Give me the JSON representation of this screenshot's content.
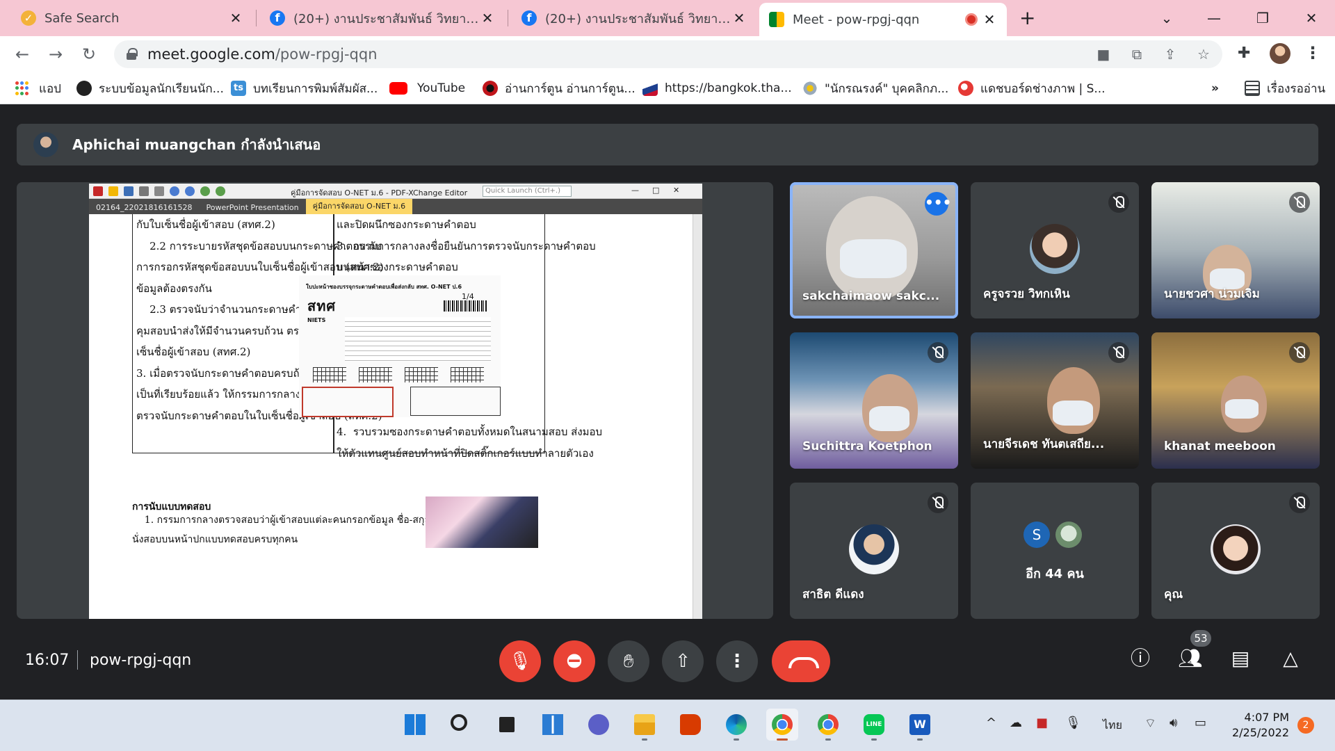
{
  "browser": {
    "tabs": [
      {
        "title": "Safe Search",
        "icon": "check-icon"
      },
      {
        "title": "(20+) งานประชาสัมพันธ์ วิทยาลัยพณิชยการ",
        "icon": "facebook-icon"
      },
      {
        "title": "(20+) งานประชาสัมพันธ์ วิทยาลัยพณิชยการ",
        "icon": "facebook-icon"
      },
      {
        "title": "Meet - pow-rpgj-qqn",
        "icon": "meet-icon",
        "active": true
      }
    ],
    "url_domain": "meet.google.com",
    "url_path": "/pow-rpgj-qqn",
    "bookmarks": [
      {
        "label": "แอป",
        "icon": "apps-icon"
      },
      {
        "label": "ระบบข้อมูลนักเรียนนัก...",
        "icon": "globe-icon"
      },
      {
        "label": "บทเรียนการพิมพ์สัมผัส...",
        "icon": "ts-icon"
      },
      {
        "label": "YouTube",
        "icon": "youtube-icon"
      },
      {
        "label": "อ่านการ์ตูน อ่านการ์ตูน...",
        "icon": "manga-icon"
      },
      {
        "label": "https://bangkok.tha...",
        "icon": "flag-icon"
      },
      {
        "label": "\"นักรณรงค์\" บุคคลิกภ...",
        "icon": "sun-icon"
      },
      {
        "label": "แดชบอร์ดช่างภาพ | S...",
        "icon": "swirl-icon"
      }
    ],
    "bookmarks_more": "»",
    "reading_list": "เรื่องรออ่าน"
  },
  "meet": {
    "presenter_label": "Aphichai muangchan กำลังนำเสนอ",
    "time": "16:07",
    "code": "pow-rpgj-qqn",
    "participants_count": "53",
    "tiles": [
      {
        "name": "sakchaimaow sakc...",
        "type": "video",
        "speaking": true
      },
      {
        "name": "ครูจรวย วิทกเหิน",
        "type": "avatar",
        "muted": true
      },
      {
        "name": "นายชวศา น่วมเจิม",
        "type": "video",
        "muted": true
      },
      {
        "name": "Suchittra Koetphon",
        "type": "video",
        "muted": true
      },
      {
        "name": "นายจีรเดช ทันตเสถีย...",
        "type": "video",
        "muted": true
      },
      {
        "name": "khanat meeboon",
        "type": "video",
        "muted": true
      },
      {
        "name": "สาธิต ดีแดง",
        "type": "avatar",
        "muted": true
      },
      {
        "name": "อีก 44 คน",
        "type": "more"
      },
      {
        "name": "คุณ",
        "type": "avatar",
        "muted": true
      }
    ],
    "more_avatar_letter": "S"
  },
  "pdf": {
    "title": "คู่มือการจัดสอบ O-NET ม.6 - PDF-XChange Editor",
    "quick_launch": "Quick Launch (Ctrl+.)",
    "tabs": [
      "02164_22021816161528",
      "PowerPoint Presentation",
      "คู่มือการจัดสอบ O-NET ม.6"
    ],
    "left_col": [
      "กับใบเซ็นชื่อผู้เข้าสอบ (สทศ.2)",
      "    2.2 การระบายรหัสชุดข้อสอบบนกระดาษคำตอบ กับ",
      "การกรอกรหัสชุดข้อสอบบนใบเซ็นชื่อผู้เข้าสอบ (สทศ.2)",
      "ข้อมูลต้องตรงกัน",
      "    2.3 ตรวจนับว่าจำนวนกระดาษคำตอบที่กรรมการ",
      "คุมสอบนำส่งให้มีจำนวนครบถ้วน ตรงกับข้อมูลในใบ",
      "เซ็นชื่อผู้เข้าสอบ (สทศ.2)",
      "3. เมื่อตรวจนับกระดาษคำตอบครบถ้วนในแต่ละห้อง",
      "เป็นที่เรียบร้อยแล้ว ให้กรรมการกลางลงนามยืนยันการ",
      "ตรวจนับกระดาษคำตอบในใบเซ็นชื่อผู้เข้าสอบ (สทศ.2)"
    ],
    "right_col_top": [
      "และปิดผนึกซองกระดาษคำตอบ",
      "3.  กรรมการกลางลงชื่อยืนยันการตรวจนับกระดาษคำตอบ",
      "บนหน้าซองกระดาษคำตอบ"
    ],
    "right_col_bottom": [
      "4.  รวบรวมซองกระดาษคำตอบทั้งหมดในสนามสอบ ส่งมอบ",
      "ให้ตัวแทนศูนย์สอบทำหน้าที่ปิดสติ๊กเกอร์แบบทำลายตัวเอง"
    ],
    "form_header": "ใบปะหน้าซองบรรจุกระดาษคำตอบเพื่อส่งกลับ สทศ. O-NET ป.6",
    "form_logo": "สทศ",
    "form_logo_sub": "NIETS",
    "form_number": "1/4",
    "section_heading": "การนับแบบทดสอบ",
    "bottom_text": [
      "    1. กรรมการกลางตรวจสอบว่าผู้เข้าสอบแต่ละคนกรอกข้อมูล ชื่อ-สกุล และเลขที่",
      "นั่งสอบบนหน้าปกแบบทดสอบครบทุกคน"
    ]
  },
  "taskbar": {
    "apps": [
      "windows-start",
      "search",
      "task-view",
      "widgets",
      "teams-chat",
      "file-explorer",
      "office",
      "edge",
      "chrome",
      "chrome-profile",
      "line",
      "word"
    ],
    "language": "ไทย",
    "time": "4:07 PM",
    "date": "2/25/2022",
    "notifications": "2"
  },
  "colors": {
    "tab_strip": "#f6c7d3",
    "meet_bg": "#202124",
    "tile_bg": "#3c4043",
    "danger": "#ea4335",
    "speaking": "#8ab4f8"
  }
}
